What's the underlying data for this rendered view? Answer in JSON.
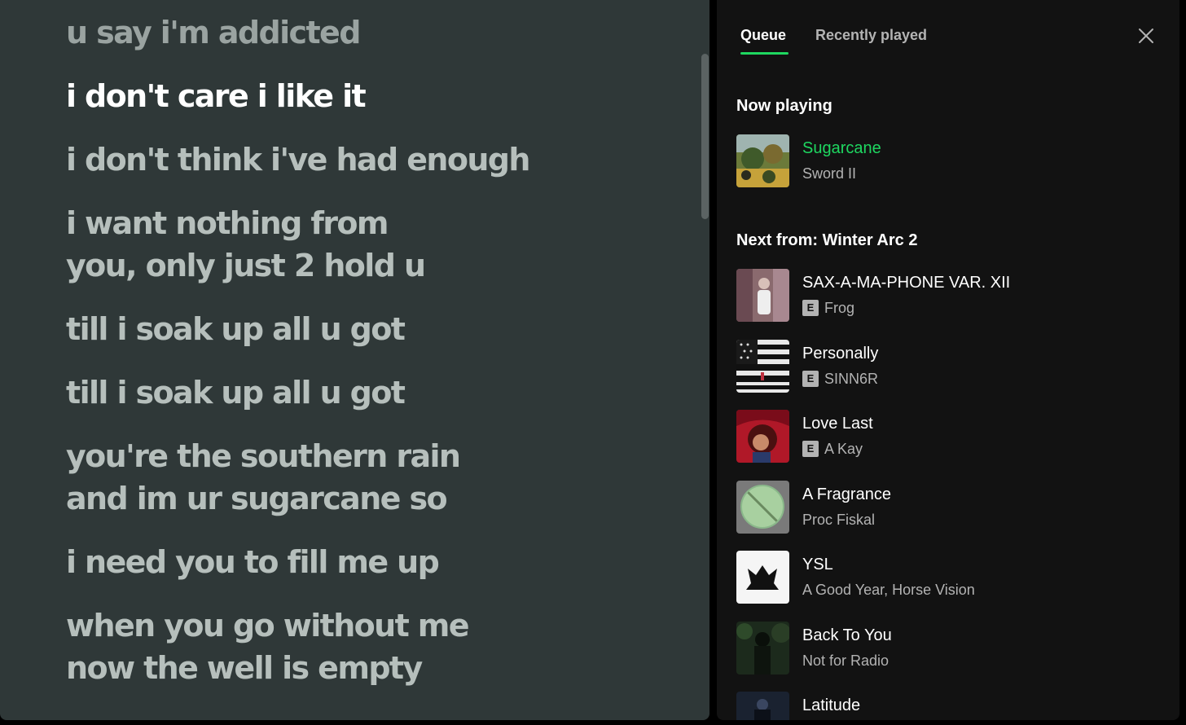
{
  "lyrics": {
    "lines": [
      "u say i'm addicted",
      "i don't care i like it",
      "i don't think i've had enough",
      "i want nothing from",
      "you, only just 2 hold u",
      "till i soak up all u got",
      "till i soak up all u got",
      "you're the southern rain",
      "and im ur sugarcane so",
      "i need you to fill me up",
      "when you go without me",
      "now the well is empty"
    ]
  },
  "queue_panel": {
    "tabs": [
      {
        "label": "Queue"
      },
      {
        "label": "Recently played"
      }
    ],
    "accent_color": "#1ed760",
    "close_icon": "close-icon",
    "now_playing": {
      "heading": "Now playing",
      "title": "Sugarcane",
      "artist": "Sword II"
    },
    "next_from": {
      "heading": "Next from: Winter Arc 2",
      "tracks": [
        {
          "title": "SAX-A-MA-PHONE VAR. XII",
          "explicit": "E",
          "artist": "Frog"
        },
        {
          "title": "Personally",
          "explicit": "E",
          "artist": "SINN6R"
        },
        {
          "title": "Love Last",
          "explicit": "E",
          "artist": "A Kay"
        },
        {
          "title": "A Fragrance",
          "artist": "Proc Fiskal"
        },
        {
          "title": "YSL",
          "artist": "A Good Year, Horse Vision"
        },
        {
          "title": "Back To You",
          "artist": "Not for Radio"
        },
        {
          "title": "Latitude"
        }
      ]
    }
  }
}
